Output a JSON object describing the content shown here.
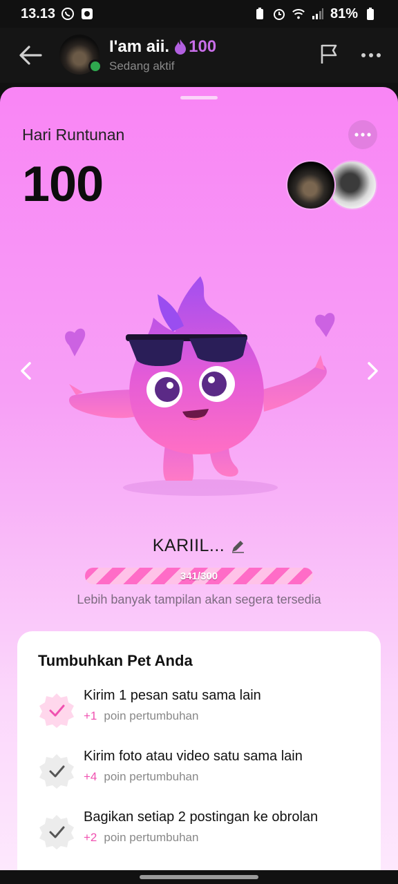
{
  "status_bar": {
    "time": "13.13",
    "battery": "81%"
  },
  "chat_header": {
    "name": "I'am aii.",
    "streak": "100",
    "status": "Sedang aktif"
  },
  "sheet": {
    "streak_label": "Hari Runtunan",
    "streak_count": "100",
    "pet_name": "KARIIL...",
    "progress_text": "341/300",
    "progress_fraction": 1.0,
    "soon_text": "Lebih banyak tampilan akan segera tersedia"
  },
  "card": {
    "title": "Tumbuhkan Pet Anda",
    "tasks": [
      {
        "title": "Kirim 1 pesan satu sama lain",
        "points": "+1",
        "unit": "poin pertumbuhan",
        "state": "done"
      },
      {
        "title": "Kirim foto atau video satu sama lain",
        "points": "+4",
        "unit": "poin pertumbuhan",
        "state": "pending"
      },
      {
        "title": "Bagikan setiap 2 postingan ke obrolan",
        "points": "+2",
        "unit": "poin pertumbuhan",
        "state": "pending"
      }
    ]
  },
  "colors": {
    "accent": "#f050b0",
    "sheet_top": "#f985f5",
    "online": "#2fa84f"
  }
}
